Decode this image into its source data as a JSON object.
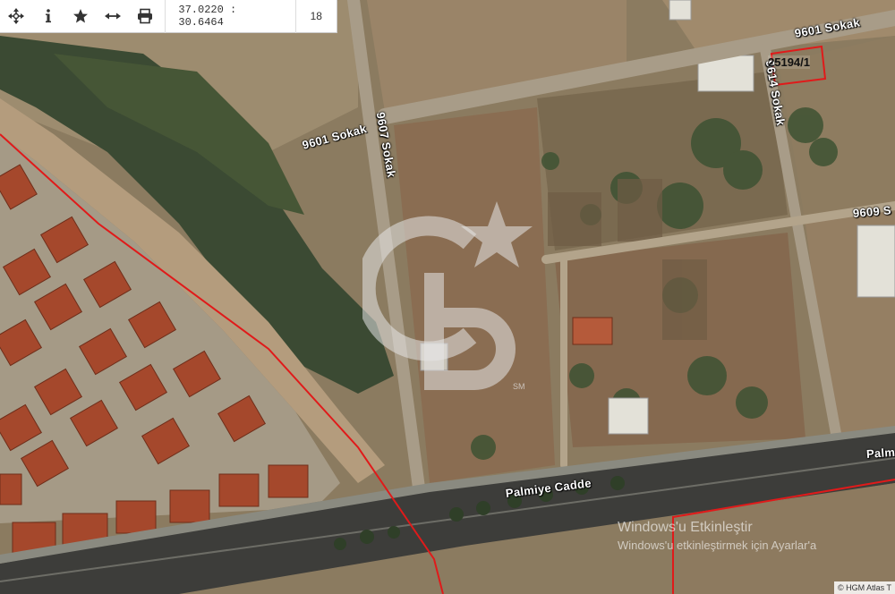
{
  "toolbar": {
    "coordinates": "37.0220 : 30.6464",
    "zoom": "18",
    "tools": [
      "pan-icon",
      "info-icon",
      "favorite-star-icon",
      "measure-icon",
      "print-icon"
    ]
  },
  "map": {
    "roads": [
      {
        "name": "9601 Sokak"
      },
      {
        "name": "9601 Sokak"
      },
      {
        "name": "9607 Sokak"
      },
      {
        "name": "9614 Sokak"
      },
      {
        "name": "9609 S"
      },
      {
        "name": "Palmiye Cadde"
      },
      {
        "name": "Palm"
      }
    ],
    "parcel_label": "25194/1",
    "logo_text": "SM"
  },
  "overlay": {
    "windows_line1": "Windows'u Etkinleştir",
    "windows_line2": "Windows'u etkinleştirmek için Ayarlar'a"
  },
  "credit": "© HGM Atlas  T",
  "colors": {
    "boundary": "#e01a1a",
    "toolbar_bg": "#ffffff"
  }
}
